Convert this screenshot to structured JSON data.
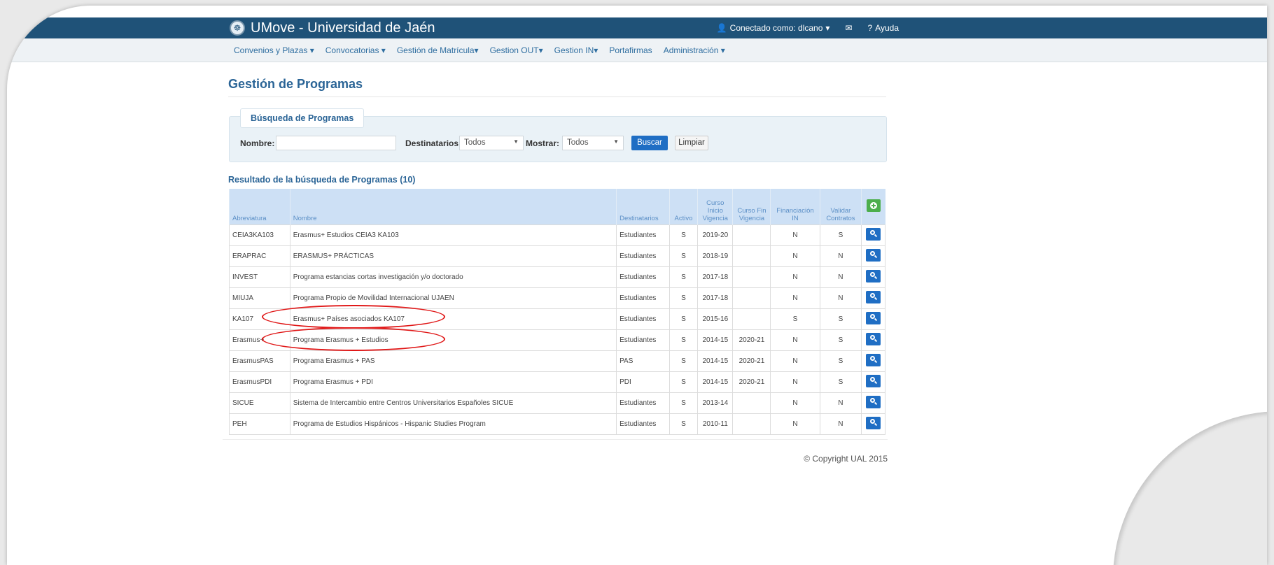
{
  "app": {
    "title": "UMove - Universidad de Jaén"
  },
  "header": {
    "connected_as": "Conectado como: dlcano",
    "help": "Ayuda"
  },
  "menu": [
    "Convenios y Plazas ▾",
    "Convocatorias ▾",
    "Gestión de Matrícula▾",
    "Gestion OUT▾",
    "Gestion IN▾",
    "Portafirmas",
    "Administración ▾"
  ],
  "page": {
    "title": "Gestión de Programas"
  },
  "search": {
    "legend": "Búsqueda de Programas",
    "nombre_label": "Nombre:",
    "nombre_value": "",
    "destinatarios_label": "Destinatarios:",
    "destinatarios_value": "Todos",
    "mostrar_label": "Mostrar:",
    "mostrar_value": "Todos",
    "buscar": "Buscar",
    "limpiar": "Limpiar"
  },
  "results": {
    "title": "Resultado de la búsqueda de Programas (10)",
    "columns": [
      "Abreviatura",
      "Nombre",
      "Destinatarios",
      "Activo",
      "Curso Inicio Vigencia",
      "Curso Fin Vigencia",
      "Financiación IN",
      "Validar Contratos"
    ],
    "rows": [
      [
        "CEIA3KA103",
        "Erasmus+ Estudios CEIA3 KA103",
        "Estudiantes",
        "S",
        "2019-20",
        "",
        "N",
        "S"
      ],
      [
        "ERAPRAC",
        "ERASMUS+ PRÁCTICAS",
        "Estudiantes",
        "S",
        "2018-19",
        "",
        "N",
        "N"
      ],
      [
        "INVEST",
        "Programa estancias cortas investigación y/o doctorado",
        "Estudiantes",
        "S",
        "2017-18",
        "",
        "N",
        "N"
      ],
      [
        "MIUJA",
        "Programa Propio de Movilidad Internacional UJAEN",
        "Estudiantes",
        "S",
        "2017-18",
        "",
        "N",
        "N"
      ],
      [
        "KA107",
        "Erasmus+ Países asociados KA107",
        "Estudiantes",
        "S",
        "2015-16",
        "",
        "S",
        "S"
      ],
      [
        "Erasmus+",
        "Programa Erasmus + Estudios",
        "Estudiantes",
        "S",
        "2014-15",
        "2020-21",
        "N",
        "S"
      ],
      [
        "ErasmusPAS",
        "Programa Erasmus + PAS",
        "PAS",
        "S",
        "2014-15",
        "2020-21",
        "N",
        "S"
      ],
      [
        "ErasmusPDI",
        "Programa Erasmus + PDI",
        "PDI",
        "S",
        "2014-15",
        "2020-21",
        "N",
        "S"
      ],
      [
        "SICUE",
        "Sistema de Intercambio entre Centros Universitarios Españoles SICUE",
        "Estudiantes",
        "S",
        "2013-14",
        "",
        "N",
        "N"
      ],
      [
        "PEH",
        "Programa de Estudios Hispánicos - Hispanic Studies Program",
        "Estudiantes",
        "S",
        "2010-11",
        "",
        "N",
        "N"
      ]
    ]
  },
  "footer": {
    "copyright": "© Copyright UAL 2015"
  },
  "colors": {
    "header": "#1f5278",
    "primary": "#1f6ec4",
    "success": "#4cae4c",
    "annotation": "#e01818"
  }
}
